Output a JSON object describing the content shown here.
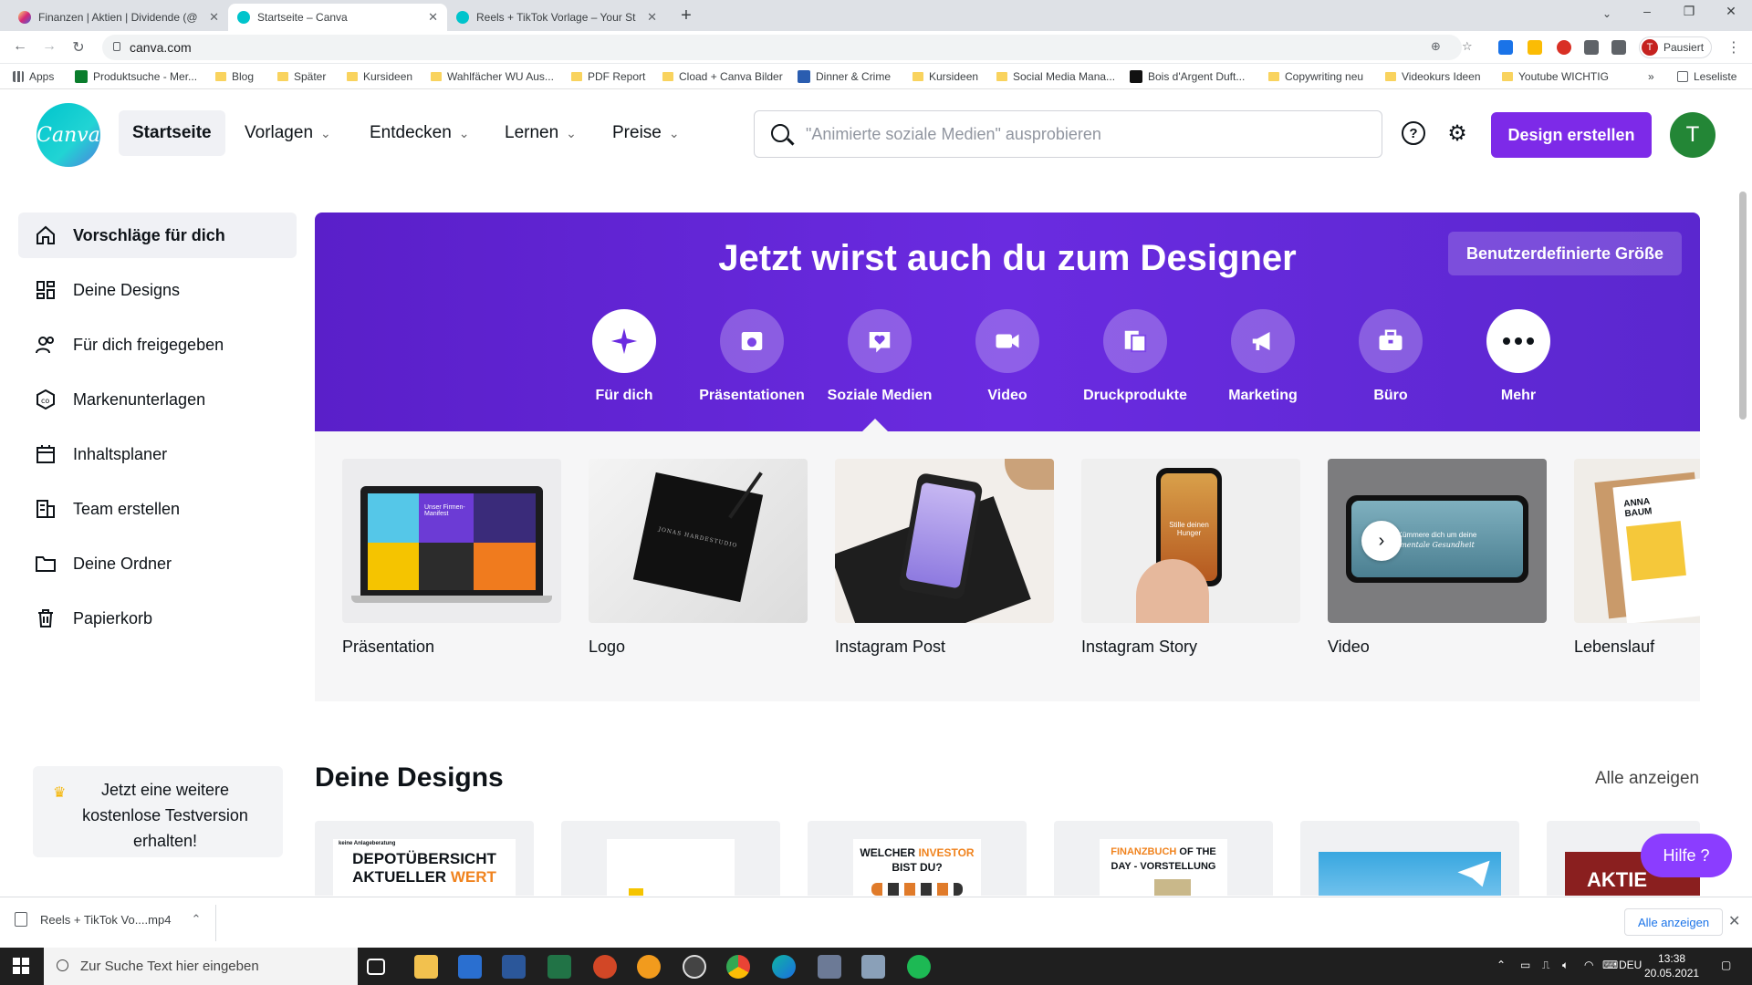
{
  "browser": {
    "tabs": [
      {
        "title": "Finanzen | Aktien | Dividende (@",
        "favicon_color": "#e1306c"
      },
      {
        "title": "Startseite – Canva",
        "favicon_color": "#00c4cc"
      },
      {
        "title": "Reels + TikTok Vorlage – Your St",
        "favicon_color": "#00c4cc"
      }
    ],
    "url": "canva.com",
    "profile_initial": "T",
    "profile_label": "Pausiert",
    "bookmarks": [
      "Apps",
      "Produktsuche - Mer...",
      "Blog",
      "Später",
      "Kursideen",
      "Wahlfächer WU Aus...",
      "PDF Report",
      "Cload + Canva Bilder",
      "Dinner & Crime",
      "Kursideen",
      "Social Media Mana...",
      "Bois d'Argent Duft...",
      "Copywriting neu",
      "Videokurs Ideen",
      "Youtube WICHTIG"
    ],
    "bookmarks_overflow": "»",
    "reading_list": "Leseliste"
  },
  "header": {
    "logo": "Canva",
    "nav": [
      "Startseite",
      "Vorlagen",
      "Entdecken",
      "Lernen",
      "Preise"
    ],
    "search_placeholder": "\"Animierte soziale Medien\" ausprobieren",
    "create_button": "Design erstellen",
    "user_initial": "T"
  },
  "sidebar": {
    "items": [
      "Vorschläge für dich",
      "Deine Designs",
      "Für dich freigegeben",
      "Markenunterlagen",
      "Inhaltsplaner",
      "Team erstellen",
      "Deine Ordner",
      "Papierkorb"
    ],
    "promo": "Jetzt eine weitere kostenlose Testversion erhalten!"
  },
  "hero": {
    "title": "Jetzt wirst auch du zum Designer",
    "custom_size": "Benutzerdefinierte Größe",
    "categories": [
      "Für dich",
      "Präsentationen",
      "Soziale Medien",
      "Video",
      "Druckprodukte",
      "Marketing",
      "Büro",
      "Mehr"
    ]
  },
  "templates": {
    "items": [
      "Präsentation",
      "Logo",
      "Instagram Post",
      "Instagram Story",
      "Video",
      "Lebenslauf"
    ],
    "presentation_thumb": [
      "Unser Firmen-Manifest"
    ],
    "logo_thumb": "JONAS HARDESTUDIO",
    "story_thumb": [
      "Stille deinen Hunger"
    ],
    "video_thumb": [
      "Kümmere dich um deine",
      "mentale Gesundheit"
    ],
    "cv_thumb": [
      "ANNA",
      "BAUM"
    ]
  },
  "designs": {
    "title": "Deine Designs",
    "see_all": "Alle anzeigen",
    "cards": [
      {
        "top": "keine Anlageberatung",
        "line1": "DEPOTÜBERSICHT",
        "line2": "AKTUELLER",
        "line2b": "WERT"
      },
      {
        "top": "",
        "line1": "",
        "line2": "",
        "line2b": ""
      },
      {
        "top": "",
        "line1": "WELCHER",
        "line1b": "INVESTOR",
        "line2": "BIST DU?",
        "line2b": ""
      },
      {
        "top": "",
        "line1": "FINANZBUCH",
        "line1b": "OF THE",
        "line2": "DAY - VORSTELLUNG",
        "line2b": ""
      },
      {
        "top": "",
        "line1": "",
        "line2": "",
        "line2b": ""
      },
      {
        "top": "",
        "line1": "AKTIE",
        "line2": "",
        "line2b": ""
      }
    ],
    "help": "Hilfe ?"
  },
  "download": {
    "file": "Reels + TikTok Vo....mp4",
    "see_all": "Alle anzeigen"
  },
  "taskbar": {
    "search": "Zur Suche Text hier eingeben",
    "lang": "DEU",
    "time": "13:38",
    "date": "20.05.2021"
  }
}
